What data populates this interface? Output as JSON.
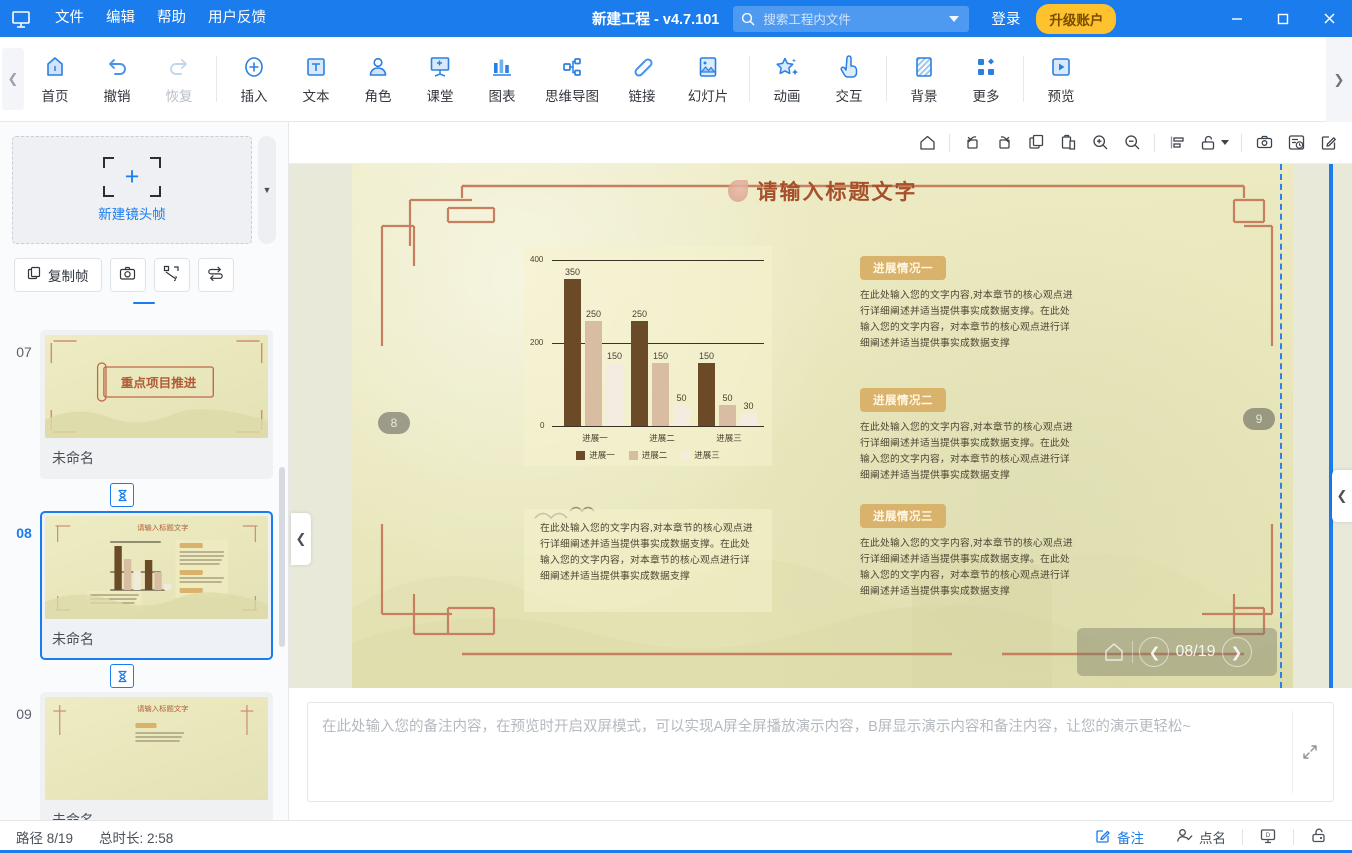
{
  "titlebar": {
    "logo_icon": "app-logo-icon",
    "menus": [
      "文件",
      "编辑",
      "帮助",
      "用户反馈"
    ],
    "project_title": "新建工程 - v4.7.101",
    "search_placeholder": "搜索工程内文件",
    "search_value": "",
    "search_icon": "search-icon",
    "dropdown_icon": "chevron-down-icon",
    "login_label": "登录",
    "upgrade_label": "升级账户",
    "minimize_icon": "minimize-icon",
    "maximize_icon": "maximize-icon",
    "close_icon": "close-icon",
    "bg_color": "#1a7ced",
    "upgrade_color": "#fdc22d"
  },
  "ribbon": {
    "collapse_icon": "chevron-left-icon",
    "expand_icon": "chevron-right-icon",
    "groups": [
      {
        "items": [
          {
            "label": "首页",
            "icon": "home-icon",
            "disabled": false
          },
          {
            "label": "撤销",
            "icon": "undo-icon",
            "disabled": false
          },
          {
            "label": "恢复",
            "icon": "redo-icon",
            "disabled": true
          }
        ]
      },
      {
        "items": [
          {
            "label": "插入",
            "icon": "plus-circle-icon",
            "disabled": false
          },
          {
            "label": "文本",
            "icon": "text-box-icon",
            "disabled": false
          },
          {
            "label": "角色",
            "icon": "person-icon",
            "disabled": false
          },
          {
            "label": "课堂",
            "icon": "whiteboard-icon",
            "disabled": false
          },
          {
            "label": "图表",
            "icon": "bar-chart-icon",
            "disabled": false
          },
          {
            "label": "思维导图",
            "icon": "mindmap-icon",
            "disabled": false
          },
          {
            "label": "链接",
            "icon": "link-icon",
            "disabled": false
          },
          {
            "label": "幻灯片",
            "icon": "slide-icon",
            "disabled": false
          }
        ]
      },
      {
        "items": [
          {
            "label": "动画",
            "icon": "star-sparkle-icon",
            "disabled": false
          },
          {
            "label": "交互",
            "icon": "hand-click-icon",
            "disabled": false
          }
        ]
      },
      {
        "items": [
          {
            "label": "背景",
            "icon": "background-icon",
            "disabled": false
          },
          {
            "label": "更多",
            "icon": "grid-more-icon",
            "disabled": false
          }
        ]
      },
      {
        "items": [
          {
            "label": "预览",
            "icon": "play-preview-icon",
            "disabled": false
          }
        ]
      }
    ]
  },
  "leftpanel": {
    "new_frame_label": "新建镜头帧",
    "new_frame_icon": "add-frame-icon",
    "frame_scroll_icon": "caret-down-icon",
    "tools": [
      {
        "label": "复制帧",
        "icon": "copy-frame-icon",
        "type": "wide"
      },
      {
        "label": "",
        "icon": "camera-icon",
        "type": "square"
      },
      {
        "label": "",
        "icon": "fit-frame-icon",
        "type": "square"
      },
      {
        "label": "",
        "icon": "reorder-icon",
        "type": "square"
      }
    ],
    "timing_icon": "hourglass-icon",
    "slides": [
      {
        "num": "07",
        "name": "未命名",
        "active": false,
        "kind": "title"
      },
      {
        "num": "08",
        "name": "未命名",
        "active": true,
        "kind": "chart"
      },
      {
        "num": "09",
        "name": "未命名",
        "active": false,
        "kind": "text"
      }
    ]
  },
  "canvas_toolbar": {
    "buttons": [
      {
        "icon": "home-outline-icon",
        "name": "canvas-home"
      },
      {
        "icon": "rotate-left-icon",
        "name": "rotate-left"
      },
      {
        "icon": "rotate-right-icon",
        "name": "rotate-right"
      },
      {
        "icon": "copy-icon",
        "name": "copy"
      },
      {
        "icon": "paste-icon",
        "name": "paste"
      },
      {
        "icon": "zoom-in-icon",
        "name": "zoom-in"
      },
      {
        "icon": "zoom-out-icon",
        "name": "zoom-out"
      },
      {
        "icon": "align-icon",
        "name": "align"
      },
      {
        "icon": "lock-open-icon",
        "name": "lock"
      },
      {
        "icon": "snapshot-icon",
        "name": "snapshot"
      },
      {
        "icon": "record-list-icon",
        "name": "record"
      },
      {
        "icon": "edit-square-icon",
        "name": "edit"
      }
    ],
    "lock_caret_icon": "caret-down-icon"
  },
  "slide": {
    "title": "请输入标题文字",
    "page_badge_left": "8",
    "page_badge_right": "9",
    "nav": {
      "home_icon": "home-outline-icon",
      "prev_icon": "arrow-left-icon",
      "next_icon": "arrow-right-icon",
      "counter": "08/19"
    },
    "blocks": [
      {
        "badge": "进展情况一",
        "body": "在此处输入您的文字内容,对本章节的核心观点进行详细阐述并适当提供事实成数据支撑。在此处输入您的文字内容，对本章节的核心观点进行详细阐述并适当提供事实成数据支撑"
      },
      {
        "badge": "进展情况二",
        "body": "在此处输入您的文字内容,对本章节的核心观点进行详细阐述并适当提供事实成数据支撑。在此处输入您的文字内容，对本章节的核心观点进行详细阐述并适当提供事实成数据支撑"
      },
      {
        "badge": "进展情况三",
        "body": "在此处输入您的文字内容,对本章节的核心观点进行详细阐述并适当提供事实成数据支撑。在此处输入您的文字内容，对本章节的核心观点进行详细阐述并适当提供事实成数据支撑"
      }
    ],
    "bottom_text": "在此处输入您的文字内容,对本章节的核心观点进行详细阐述并适当提供事实成数据支撑。在此处输入您的文字内容，对本章节的核心观点进行详细阐述并适当提供事实成数据支撑"
  },
  "chart_data": {
    "type": "bar",
    "title": "",
    "xlabel": "",
    "ylabel": "",
    "categories": [
      "进展一",
      "进展二",
      "进展三"
    ],
    "series": [
      {
        "name": "进展一",
        "values": [
          350,
          250,
          150
        ],
        "color": "#6b4a28"
      },
      {
        "name": "进展二",
        "values": [
          250,
          150,
          50
        ],
        "color": "#d9bda2"
      },
      {
        "name": "进展三",
        "values": [
          150,
          50,
          30
        ],
        "color": "#f3ece0"
      }
    ],
    "yticks": [
      0,
      200,
      400
    ],
    "ylim": [
      0,
      400
    ],
    "grid": true,
    "legend_position": "bottom",
    "legend": [
      "进展一",
      "进展二",
      "进展三"
    ]
  },
  "notes": {
    "placeholder": "在此处输入您的备注内容，在预览时开启双屏模式，可以实现A屏全屏播放演示内容，B屏显示演示内容和备注内容，让您的演示更轻松~",
    "value": "",
    "expand_icon": "expand-diagonal-icon"
  },
  "statusbar": {
    "path_label": "路径 8/19",
    "duration_label": "总时长: 2:58",
    "buttons": [
      {
        "label": "备注",
        "icon": "note-edit-icon",
        "active": true
      },
      {
        "label": "点名",
        "icon": "roll-call-icon",
        "active": false
      },
      {
        "label": "",
        "icon": "monitor-b-icon",
        "active": false
      },
      {
        "label": "",
        "icon": "lock-small-icon",
        "active": false
      }
    ]
  }
}
